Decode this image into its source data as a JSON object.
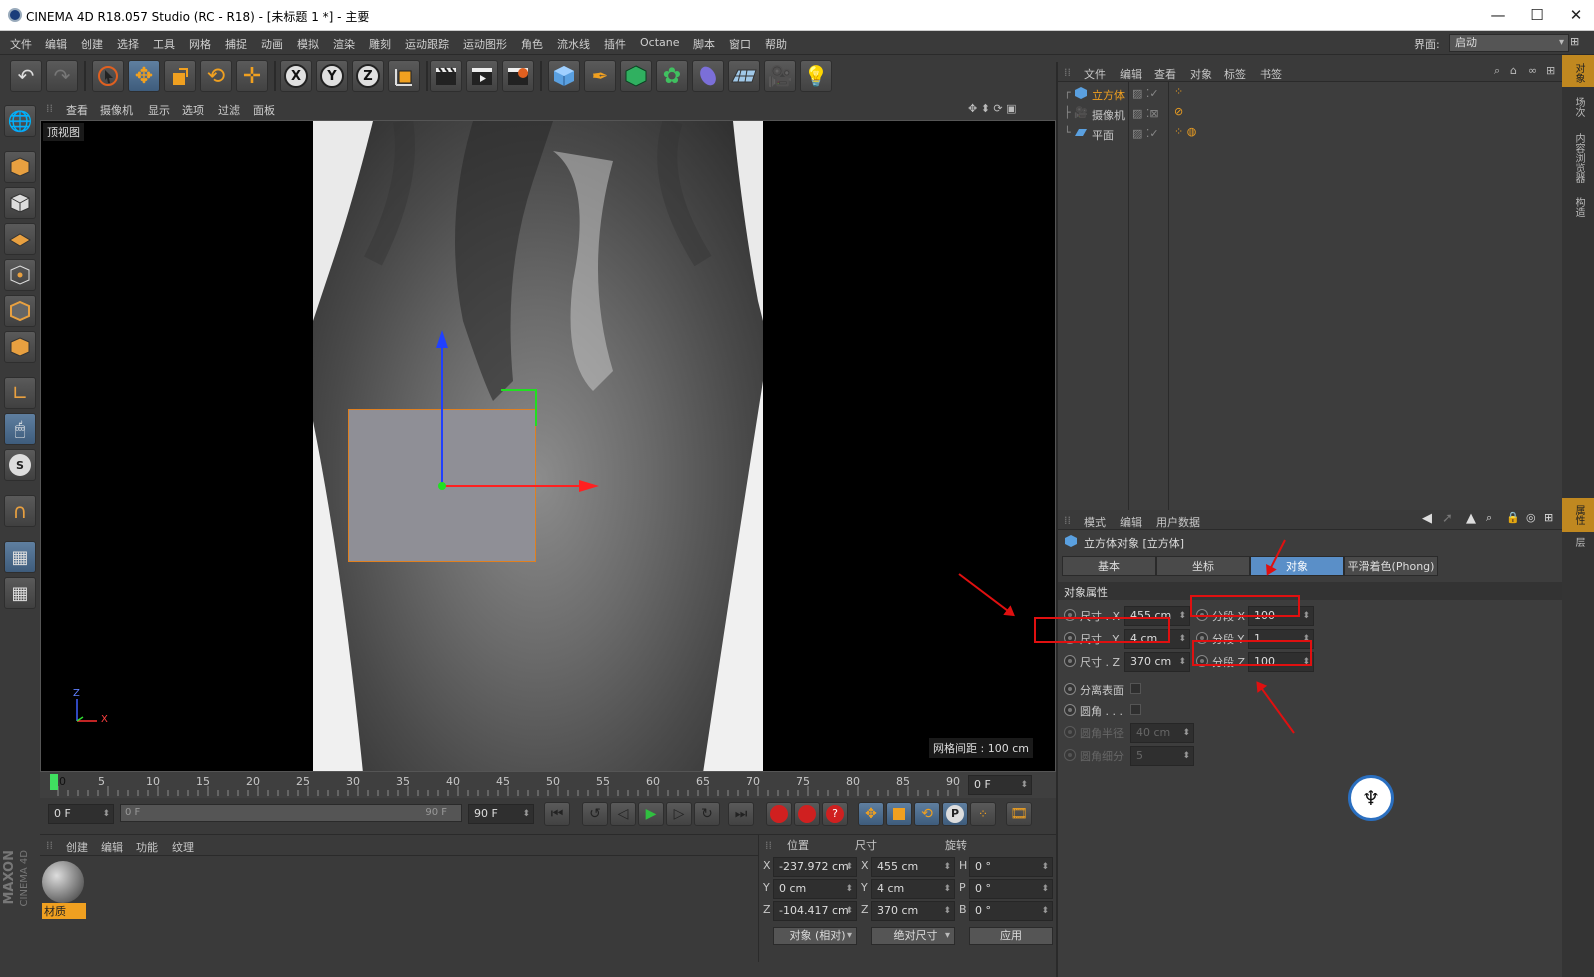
{
  "titlebar": {
    "title": "CINEMA 4D R18.057 Studio (RC - R18) - [未标题 1 *] - 主要",
    "minimize": "—",
    "maximize": "☐",
    "close": "✕"
  },
  "menubar": {
    "items": [
      "文件",
      "编辑",
      "创建",
      "选择",
      "工具",
      "网格",
      "捕捉",
      "动画",
      "模拟",
      "渲染",
      "雕刻",
      "运动跟踪",
      "运动图形",
      "角色",
      "流水线",
      "插件",
      "Octane",
      "脚本",
      "窗口",
      "帮助"
    ],
    "layout_label": "界面:",
    "layout_value": "启动"
  },
  "viewport": {
    "menu": [
      "查看",
      "摄像机",
      "显示",
      "选项",
      "过滤",
      "面板"
    ],
    "view_name": "顶视图",
    "grid_spacing": "网格间距 : 100 cm",
    "axis_z": "Z",
    "axis_x": "X"
  },
  "timeline": {
    "ticks": [
      "0",
      "5",
      "10",
      "15",
      "20",
      "25",
      "30",
      "35",
      "40",
      "45",
      "50",
      "55",
      "60",
      "65",
      "70",
      "75",
      "80",
      "85",
      "90"
    ],
    "current_frame": "0 F"
  },
  "tlcontrols": {
    "start": "0 F",
    "range_start": "0 F",
    "range_end": "90 F",
    "end": "90 F"
  },
  "material": {
    "menu": [
      "创建",
      "编辑",
      "功能",
      "纹理"
    ],
    "mat_name": "材质"
  },
  "coords": {
    "headers": [
      "位置",
      "尺寸",
      "旋转"
    ],
    "rows": [
      {
        "axis": "X",
        "pos": "-237.972 cm",
        "sax": "X",
        "size": "455 cm",
        "rax": "H",
        "rot": "0 °"
      },
      {
        "axis": "Y",
        "pos": "0 cm",
        "sax": "Y",
        "size": "4 cm",
        "rax": "P",
        "rot": "0 °"
      },
      {
        "axis": "Z",
        "pos": "-104.417 cm",
        "sax": "Z",
        "size": "370 cm",
        "rax": "B",
        "rot": "0 °"
      }
    ],
    "mode": "对象 (相对)",
    "size_mode": "绝对尺寸",
    "apply": "应用"
  },
  "objmgr": {
    "menu": [
      "文件",
      "编辑",
      "查看",
      "对象",
      "标签",
      "书签"
    ],
    "objects": [
      {
        "name": "立方体",
        "selected": true
      },
      {
        "name": "摄像机",
        "selected": false
      },
      {
        "name": "平面",
        "selected": false
      }
    ]
  },
  "attrmgr": {
    "menu": [
      "模式",
      "编辑",
      "用户数据"
    ],
    "object_title": "立方体对象 [立方体]",
    "tabs": [
      "基本",
      "坐标",
      "对象",
      "平滑着色(Phong)"
    ],
    "active_tab": "对象",
    "section": "对象属性",
    "size_x_label": "尺寸 . X",
    "size_x": "455 cm",
    "size_y_label": "尺寸 . Y",
    "size_y": "4 cm",
    "size_z_label": "尺寸 . Z",
    "size_z": "370 cm",
    "seg_x_label": "分段 X",
    "seg_x": "100",
    "seg_y_label": "分段 Y",
    "seg_y": "1",
    "seg_z_label": "分段 Z",
    "seg_z": "100",
    "separate_label": "分离表面",
    "fillet_label": "圆角 . . .",
    "fillet_radius_label": "圆角半径",
    "fillet_radius": "40 cm",
    "fillet_sub_label": "圆角细分",
    "fillet_sub": "5"
  },
  "rightstrip": {
    "tabs_top": [
      "对象",
      "场次",
      "内容浏览器",
      "构造"
    ],
    "tabs_bottom": [
      "属性",
      "层"
    ]
  },
  "brand": {
    "maxon": "MAXON",
    "c4d": "CINEMA 4D"
  },
  "colors": {
    "accent": "#e8a020",
    "selected_blue": "#4a7fb5",
    "annotation_red": "#e01010"
  }
}
